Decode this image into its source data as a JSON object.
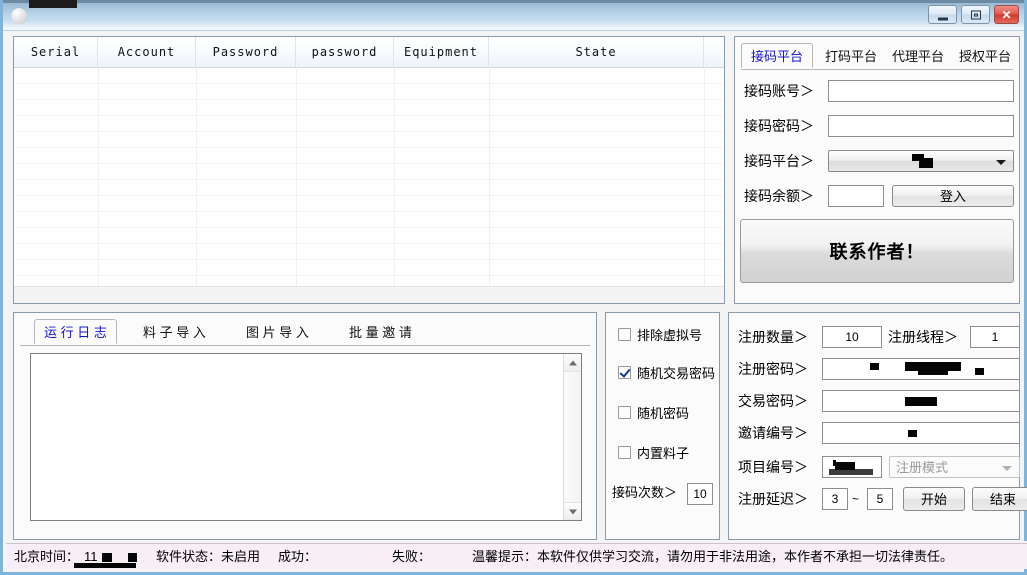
{
  "window": {
    "title": "",
    "title_redacted": true,
    "controls": {
      "minimize": "─",
      "maximize": "□",
      "close": "✕"
    },
    "icon": "app-icon"
  },
  "accounts_table": {
    "columns": [
      "Serial",
      "Account",
      "Password",
      "password",
      "Equipment",
      "State"
    ],
    "rows": []
  },
  "platform_panel": {
    "tabs": [
      {
        "label": "接码平台",
        "active": true
      },
      {
        "label": "打码平台",
        "active": false
      },
      {
        "label": "代理平台",
        "active": false
      },
      {
        "label": "授权平台",
        "active": false
      }
    ],
    "fields": {
      "account_label": "接码账号＞",
      "account_value": "",
      "password_label": "接码密码＞",
      "password_value": "",
      "platform_label": "接码平台＞",
      "platform_value": "",
      "balance_label": "接码余额＞",
      "balance_value": ""
    },
    "login_button": "登入"
  },
  "contact": {
    "label": "联系作者！"
  },
  "log_panel": {
    "tabs": [
      {
        "label": "运 行 日 志",
        "active": true
      },
      {
        "label": "料 子 导 入",
        "active": false
      },
      {
        "label": "图 片 导 入",
        "active": false
      },
      {
        "label": "批 量 邀 请",
        "active": false
      }
    ],
    "log_text": ""
  },
  "options_panel": {
    "checkboxes": [
      {
        "label": "排除虚拟号",
        "checked": false
      },
      {
        "label": "随机交易密码",
        "checked": true
      },
      {
        "label": "随机密码",
        "checked": false
      },
      {
        "label": "内置料子",
        "checked": false
      }
    ],
    "code_count_label": "接码次数＞",
    "code_count_value": "10"
  },
  "register_panel": {
    "count_label": "注册数量＞",
    "count_value": "10",
    "thread_label": "注册线程＞",
    "thread_value": "1",
    "reg_password_label": "注册密码＞",
    "reg_password_value": "",
    "trade_password_label": "交易密码＞",
    "trade_password_value": "",
    "invite_label": "邀请编号＞",
    "invite_value": "",
    "project_label": "项目编号＞",
    "project_value": "",
    "mode_placeholder": "注册模式",
    "delay_label": "注册延迟＞",
    "delay_min": "3",
    "delay_sep": "~",
    "delay_max": "5",
    "start_button": "开始",
    "stop_button": "结束"
  },
  "statusbar": {
    "time_label": "北京时间：",
    "time_value": "11",
    "software_status": "软件状态：未启用",
    "success_label": "成功：",
    "fail_label": "失败：",
    "warning": "温馨提示：本软件仅供学习交流，请勿用于非法用途，本作者不承担一切法律责任。"
  },
  "colors": {
    "title_bar_top": "#8ba4bd",
    "title_bar_bottom": "#f6f9fc",
    "window_border": "#7fb4d8",
    "active_tab_text": "#1414cf",
    "close_button": "#cf3a2c",
    "statusbar_bg": "#f7eef6"
  }
}
